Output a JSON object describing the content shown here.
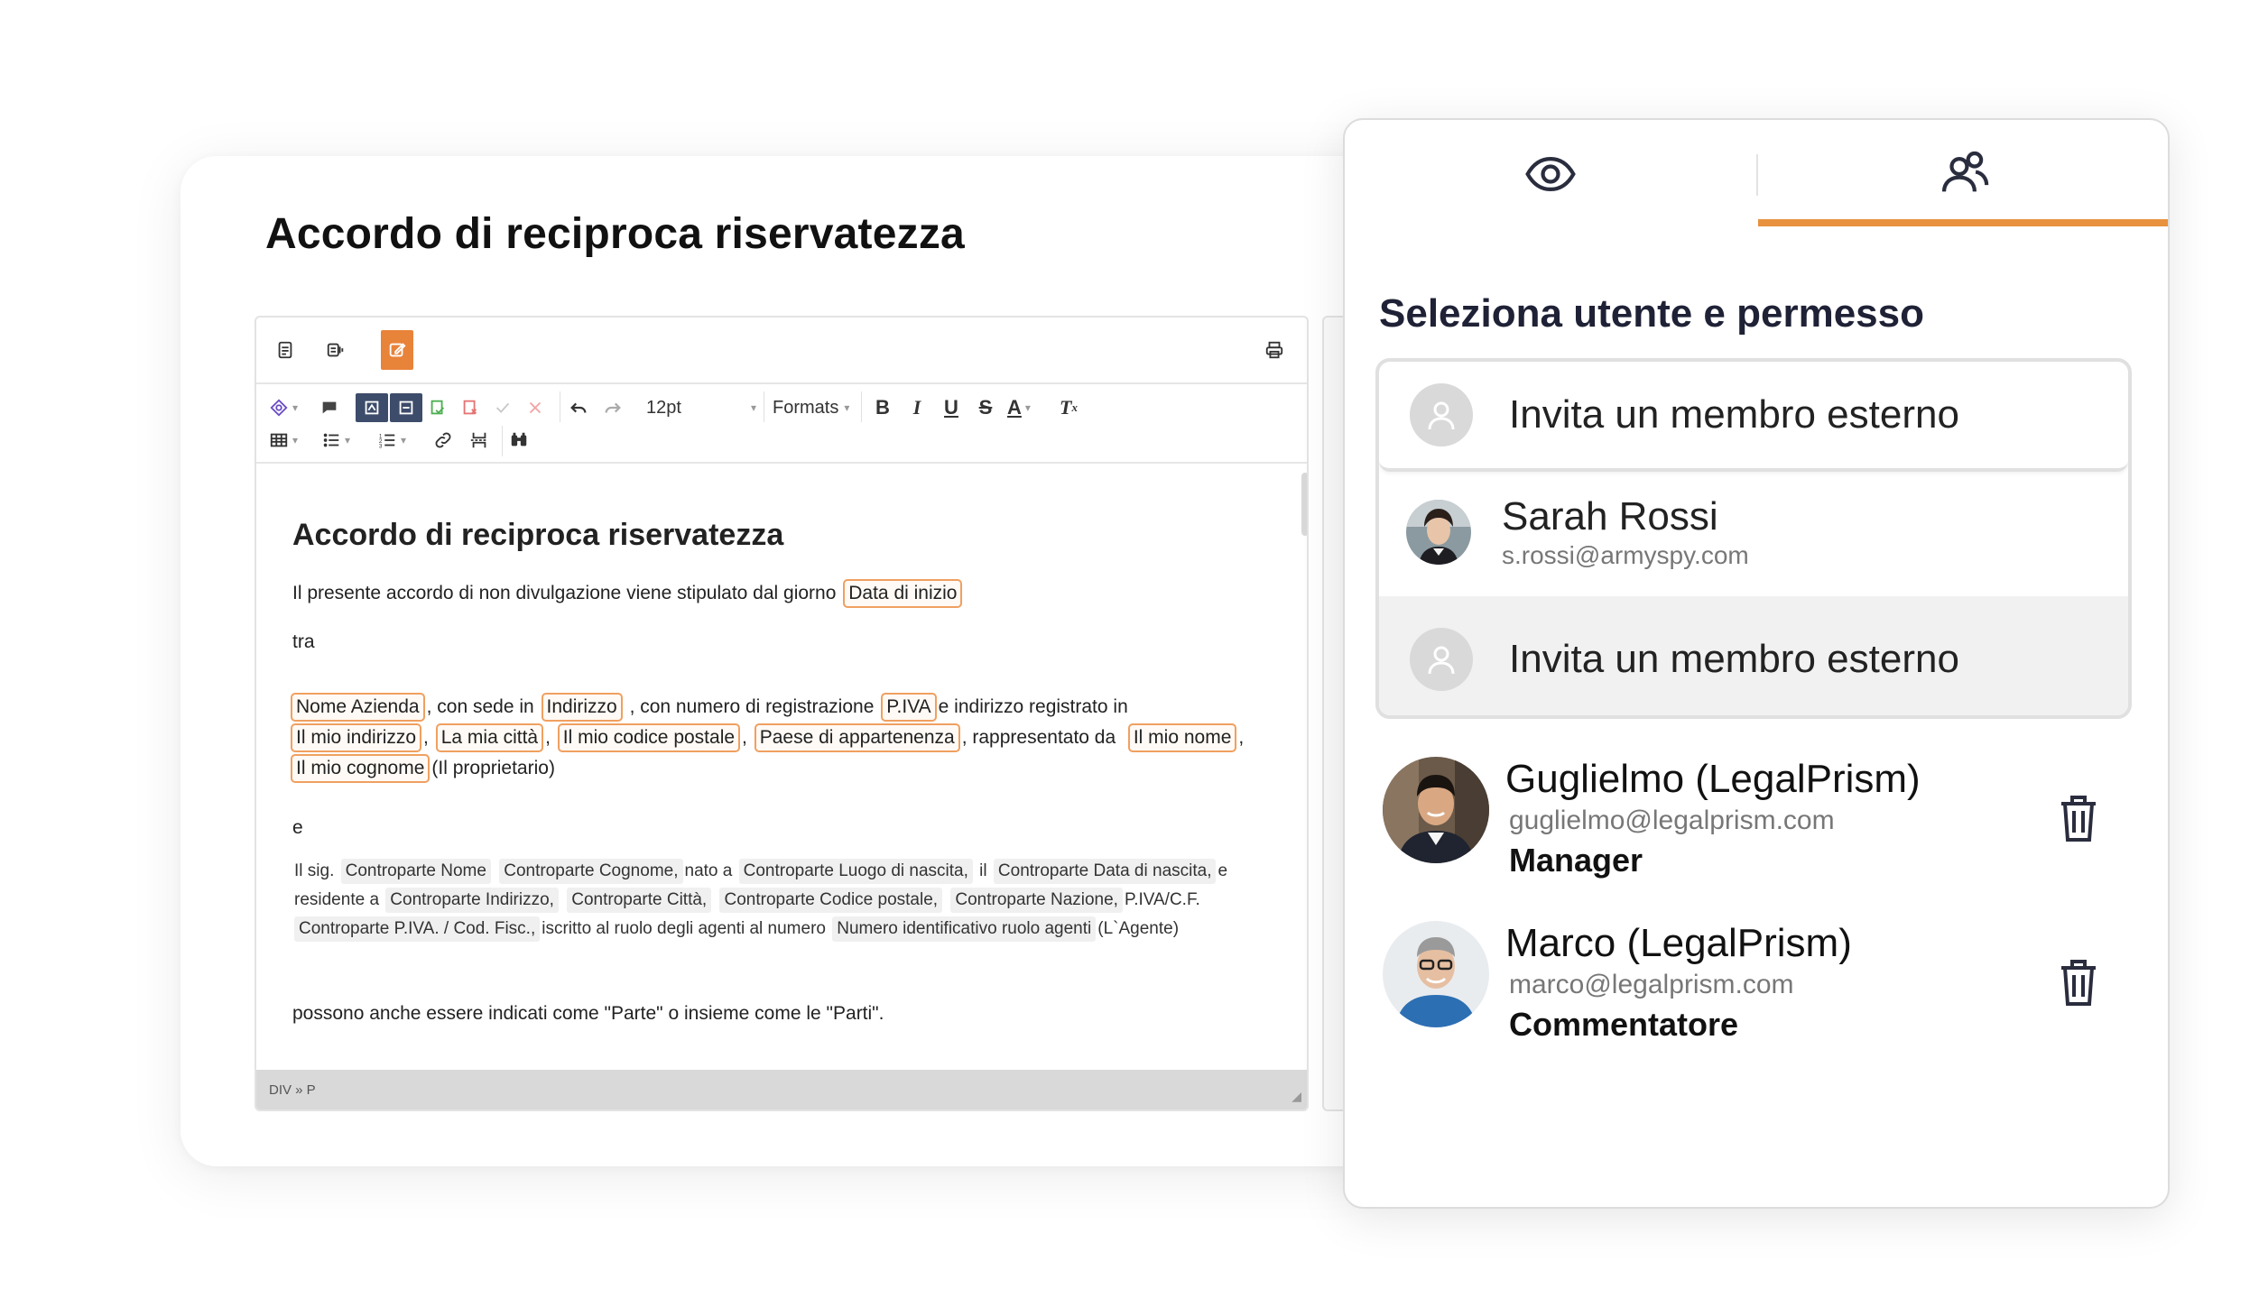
{
  "document": {
    "title": "Accordo di reciproca riservatezza"
  },
  "editor": {
    "font_size": "12pt",
    "formats_label": "Formats",
    "heading": "Accordo di reciproca riservatezza",
    "line1_text": "Il presente accordo di non divulgazione viene stipulato dal giorno",
    "line1_tag": "Data di inizio",
    "line2": "tra",
    "p1": {
      "t_nome_azienda": "Nome Azienda",
      "s1": ", con sede  in",
      "t_indirizzo": "Indirizzo",
      "s2": " , con numero di registrazione",
      "t_piva": "P.IVA",
      "s3": "e indirizzo registrato in",
      "t_mio_indirizzo": "Il mio indirizzo",
      "t_mia_citta": "La mia città",
      "t_codice_postale": "Il mio codice postale",
      "t_paese": "Paese di appartenenza",
      "s4": ", rappresentato da",
      "t_mio_nome": "Il mio nome",
      "t_mio_cognome": "Il mio cognome",
      "s5": "(Il proprietario)"
    },
    "e_line": "e",
    "p2": {
      "s1": "Il sig.",
      "f_nome": "Controparte Nome",
      "f_cognome": "Controparte Cognome,",
      "s2": "nato a",
      "f_luogo": "Controparte Luogo di nascita,",
      "s3": "il",
      "f_data": "Controparte Data di nascita,",
      "s4": "e",
      "s5": "residente a",
      "f_indirizzo": "Controparte Indirizzo,",
      "f_citta": "Controparte Città,",
      "f_cap": "Controparte Codice postale,",
      "f_nazione": "Controparte Nazione,",
      "s6": "P.IVA/C.F.",
      "f_piva": "Controparte P.IVA. / Cod. Fisc.,",
      "s7": "iscritto al ruolo degli agenti al numero",
      "f_ruolo": "Numero identificativo ruolo agenti",
      "s8": "(L`Agente)"
    },
    "closing": "possono anche essere indicati come \"Parte\" o insieme come le \"Parti\".",
    "status_path": "DIV » P"
  },
  "panel": {
    "tabs": [
      {
        "icon": "eye-icon",
        "active": false
      },
      {
        "icon": "users-icon",
        "active": true
      }
    ],
    "accent_color": "#e8913e",
    "title": "Seleziona utente e permesso",
    "dropdown": {
      "invite_label_1": "Invita un membro esterno",
      "user_name": "Sarah Rossi",
      "user_email": "s.rossi@armyspy.com",
      "invite_label_2": "Invita un membro esterno"
    },
    "members": [
      {
        "name": "Guglielmo (LegalPrism)",
        "email": "guglielmo@legalprism.com",
        "role": "Manager"
      },
      {
        "name": "Marco (LegalPrism)",
        "email": "marco@legalprism.com",
        "role": "Commentatore"
      }
    ]
  }
}
